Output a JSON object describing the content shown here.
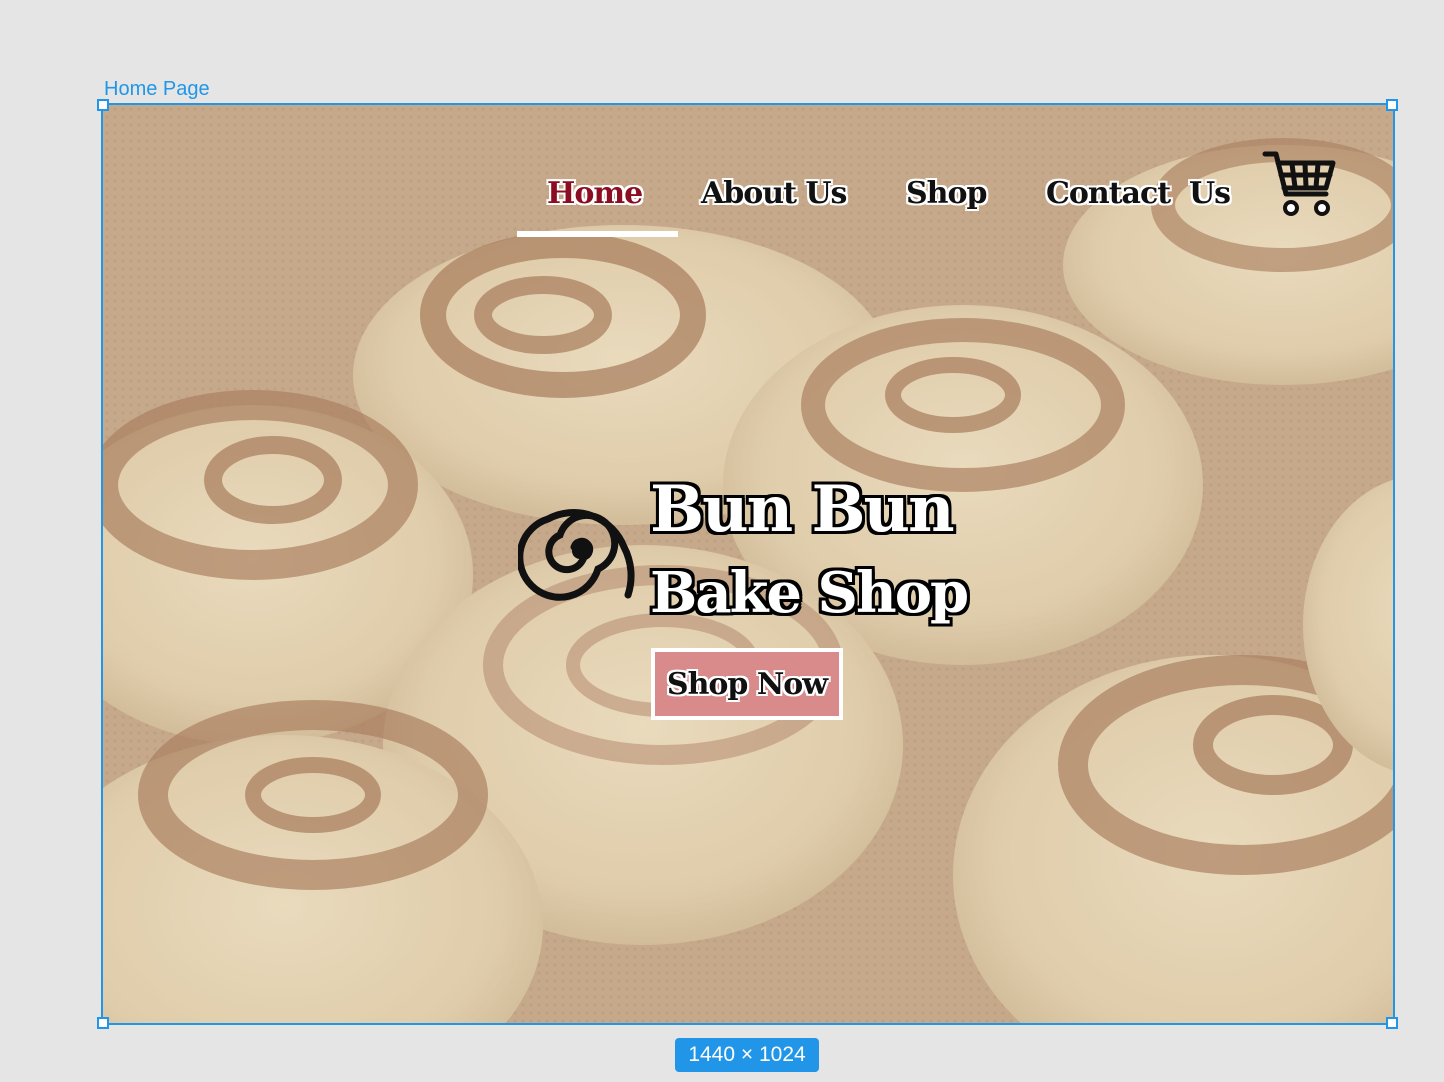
{
  "canvas": {
    "frame_label": "Home Page",
    "size_badge": "1440 × 1024",
    "accent_color": "#2196e8",
    "background_color": "#e5e5e5"
  },
  "nav": {
    "items": [
      {
        "label": "Home",
        "active": true
      },
      {
        "label": "About Us",
        "active": false
      },
      {
        "label": "Shop",
        "active": false
      },
      {
        "label": "Contact  Us",
        "active": false
      }
    ],
    "active_color": "#8a0d22",
    "cart_icon": "shopping-cart-icon"
  },
  "hero": {
    "background": "cinnamon rolls on baking mat",
    "logo_icon": "spiral-icon",
    "brand_line1": "Bun Bun",
    "brand_line2": "Bake Shop",
    "cta_label": "Shop Now",
    "cta_color": "#d98a8a"
  }
}
